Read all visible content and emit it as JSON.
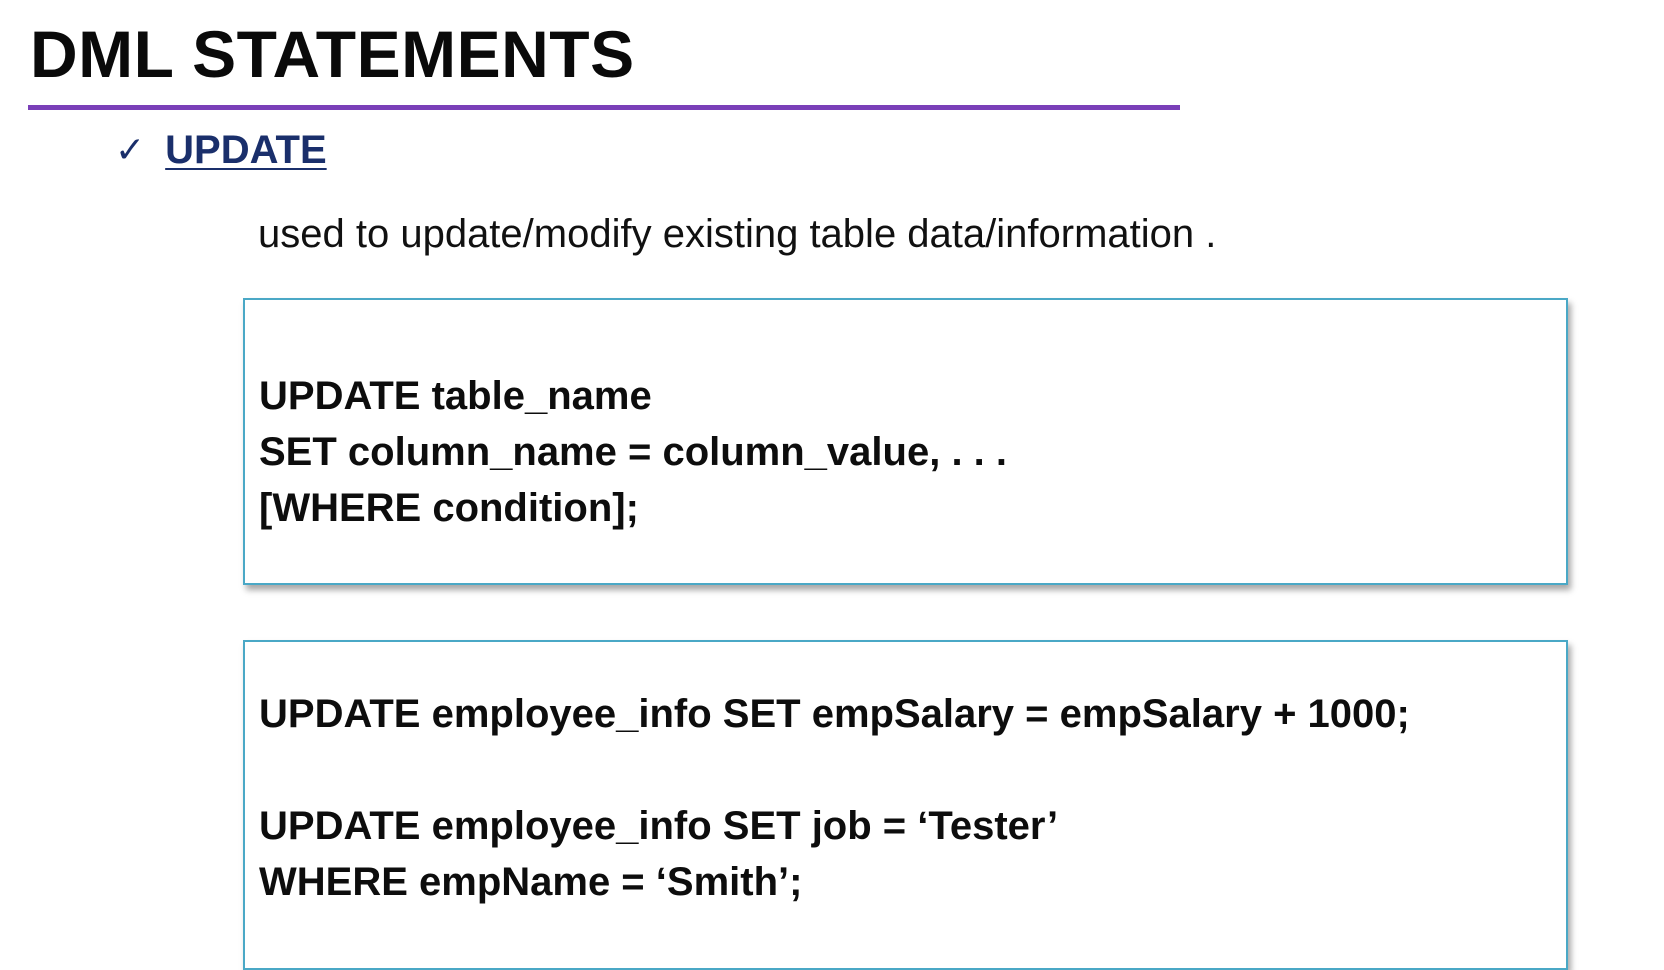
{
  "slide": {
    "title": "DML STATEMENTS",
    "bullet_label": "UPDATE",
    "description": "used to update/modify existing table data/information ."
  },
  "syntax_box": {
    "lines": [
      "UPDATE table_name",
      "SET column_name = column_value, . . .",
      "[WHERE condition];"
    ]
  },
  "example_box": {
    "lines": [
      "UPDATE employee_info SET empSalary = empSalary + 1000;",
      "UPDATE employee_info SET job = ‘Tester’",
      "WHERE empName = ‘Smith’;"
    ]
  },
  "colors": {
    "title_rule": "#7a3fb8",
    "bullet": "#1a2f6b",
    "box_border": "#4aa8c6"
  }
}
